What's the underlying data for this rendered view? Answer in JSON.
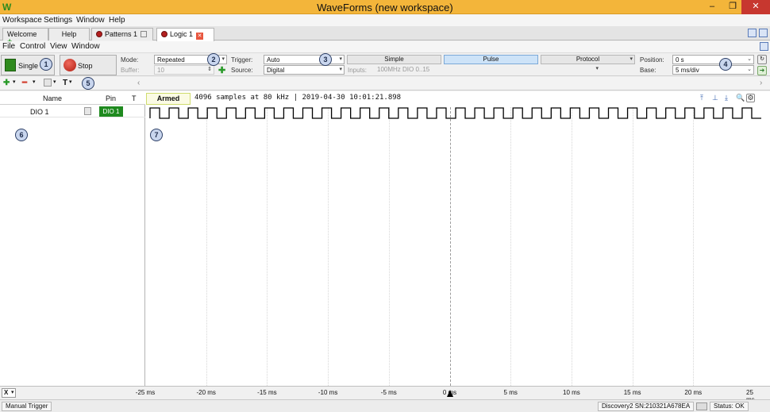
{
  "window": {
    "title": "WaveForms (new workspace)",
    "logo_icon": "waveforms-logo-icon",
    "minimize_glyph": "–",
    "maximize_glyph": "❐",
    "close_glyph": "✕"
  },
  "menu": [
    "Workspace",
    "Settings",
    "Window",
    "Help"
  ],
  "tabs": [
    {
      "label": "Welcome",
      "icon": "plus-icon"
    },
    {
      "label": "Help"
    },
    {
      "label": "Patterns 1",
      "icon": "record-icon"
    },
    {
      "label": "Logic 1",
      "icon": "record-icon",
      "active": true
    }
  ],
  "submenu": [
    "File",
    "Control",
    "View",
    "Window"
  ],
  "controls": {
    "single_label": "Single",
    "stop_label": "Stop",
    "mode_label": "Mode:",
    "mode_value": "Repeated",
    "buffer_label": "Buffer:",
    "buffer_value": "10",
    "trigger_label": "Trigger:",
    "trigger_value": "Auto",
    "source_label": "Source:",
    "source_value": "Digital",
    "inputs_label": "Inputs:",
    "inputs_value": "100MHz DIO 0..15",
    "trigger_modes": [
      "Simple",
      "Pulse",
      "Protocol"
    ],
    "active_mode": "Pulse",
    "position_label": "Position:",
    "position_value": "0 s",
    "base_label": "Base:",
    "base_value": "5 ms/div"
  },
  "callouts": [
    "1",
    "2",
    "3",
    "4",
    "5",
    "6",
    "7"
  ],
  "channels": {
    "headers": {
      "name": "Name",
      "pin": "Pin",
      "trigger": "T"
    },
    "rows": [
      {
        "name": "DIO 1",
        "pin": "DIO 1",
        "color": "#1f8a1f"
      }
    ]
  },
  "plot": {
    "state": "Armed",
    "info": "4096 samples at 80 kHz | 2019-04-30 10:01:21.898",
    "signal_periods": 32,
    "signal_color": "#000000"
  },
  "axis": {
    "unit_selector": "X",
    "ticks": [
      "-25 ms",
      "-20 ms",
      "-15 ms",
      "-10 ms",
      "-5 ms",
      "0 ms",
      "5 ms",
      "10 ms",
      "15 ms",
      "20 ms",
      "25 ms"
    ]
  },
  "status": {
    "manual_trigger": "Manual Trigger",
    "device": "Discovery2 SN:210321A678EA",
    "state": "Status: OK"
  },
  "colors": {
    "titlebar": "#f3b53a",
    "accent": "#cde3f8",
    "pin_badge": "#1f8a1f"
  }
}
